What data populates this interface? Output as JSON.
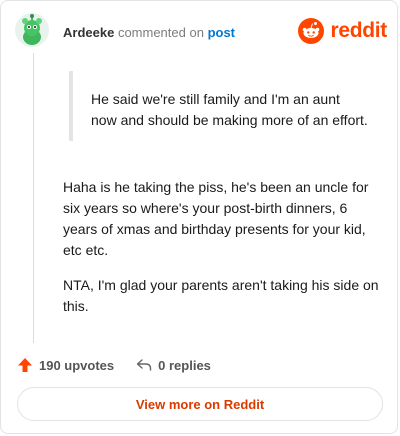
{
  "header": {
    "username": "Ardeeke",
    "action_text": "commented on",
    "post_link": "post",
    "brand": "reddit"
  },
  "icons": {
    "avatar": "snoo-avatar-icon",
    "brand_logo": "reddit-logo-icon",
    "upvote": "upvote-arrow-icon",
    "reply": "reply-arrow-icon"
  },
  "comment": {
    "quote": "He said we're still family and I'm an aunt now and should be making more of an effort.",
    "paragraphs": [
      "Haha is he taking the piss, he's been an uncle for six years so where's your post-birth dinners, 6 years of xmas and birthday presents for your kid, etc etc.",
      "NTA, I'm glad your parents aren't taking his side on this."
    ]
  },
  "actions": {
    "upvotes": "190 upvotes",
    "replies": "0 replies"
  },
  "cta": {
    "label": "View more on Reddit"
  },
  "colors": {
    "brand": "#ff4500",
    "link": "#0079d3",
    "cta_text": "#d93a00"
  }
}
